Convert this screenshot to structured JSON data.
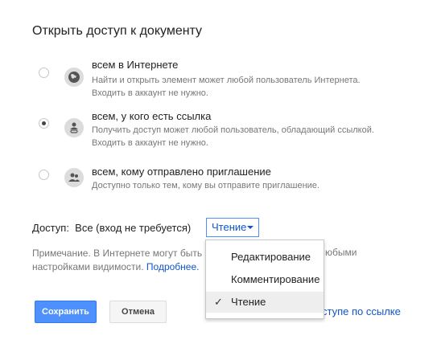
{
  "dialog": {
    "title": "Открыть доступ к документу"
  },
  "options": [
    {
      "title": "всем в Интернете",
      "desc1": "Найти и открыть элемент может любой пользователь Интернета.",
      "desc2": "Входить в аккаунт не нужно.",
      "icon": "globe-icon",
      "checked": false
    },
    {
      "title": "всем, у кого есть ссылка",
      "desc1": "Получить доступ может любой пользователь, обладающий ссылкой.",
      "desc2": "Входить в аккаунт не нужно.",
      "icon": "link-person-icon",
      "checked": true
    },
    {
      "title": "всем, кому отправлено приглашение",
      "desc1": "Доступно только тем, кому вы отправите приглашение.",
      "desc2": "",
      "icon": "people-icon",
      "checked": false
    }
  ],
  "access": {
    "label": "Доступ:",
    "value": "Все (вход не требуется)",
    "dropdown_selected": "Чтение"
  },
  "note": {
    "text": "Примечание. В Интернете могут быть",
    "text2": "настройками видимости.",
    "link": "Подробнее.",
    "tail": "юбыми"
  },
  "buttons": {
    "save": "Сохранить",
    "cancel": "Отмена"
  },
  "link_tail": "ступе по ссылке",
  "menu": {
    "items": [
      "Редактирование",
      "Комментирование",
      "Чтение"
    ],
    "selected_index": 2,
    "check": "✓"
  },
  "colors": {
    "accent": "#4d90fe",
    "link": "#1155cc"
  }
}
